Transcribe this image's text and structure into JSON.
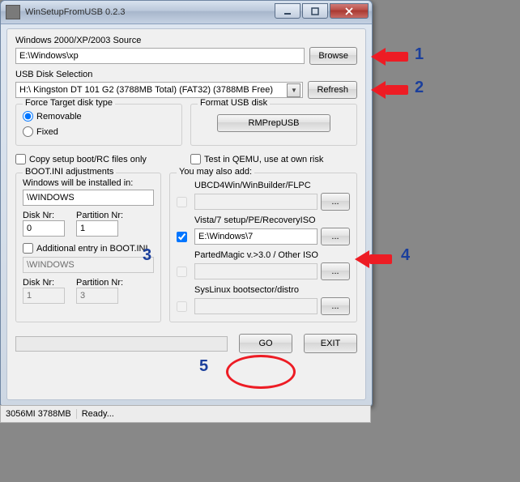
{
  "window": {
    "title": "WinSetupFromUSB 0.2.3"
  },
  "source": {
    "label": "Windows 2000/XP/2003 Source",
    "value": "E:\\Windows\\xp",
    "browse": "Browse"
  },
  "usb": {
    "label": "USB Disk Selection",
    "value": "H:\\ Kingston DT 101 G2 (3788MB Total) (FAT32) (3788MB Free)",
    "refresh": "Refresh"
  },
  "force": {
    "legend": "Force Target disk type",
    "removable": "Removable",
    "fixed": "Fixed"
  },
  "format": {
    "legend": "Format USB disk",
    "rmprep": "RMPrepUSB"
  },
  "copy_rc": "Copy setup boot/RC files only",
  "test_qemu": "Test in QEMU, use at own risk",
  "bootini": {
    "legend": "BOOT.INI adjustments",
    "installed_in": "Windows will be installed in:",
    "path1": "\\WINDOWS",
    "disknr_lbl": "Disk Nr:",
    "disknr1": "0",
    "partnr_lbl": "Partition Nr:",
    "partnr1": "1",
    "additional": "Additional entry in BOOT.INI",
    "path2": "\\WINDOWS",
    "disknr2": "1",
    "partnr2": "3"
  },
  "also": {
    "legend": "You may also add:",
    "items": [
      {
        "label": "UBCD4Win/WinBuilder/FLPC",
        "value": "",
        "checked": false,
        "enabled": false,
        "browse": "..."
      },
      {
        "label": "Vista/7 setup/PE/RecoveryISO",
        "value": "E:\\Windows\\7",
        "checked": true,
        "enabled": true,
        "browse": "..."
      },
      {
        "label": "PartedMagic v.>3.0 / Other ISO",
        "value": "",
        "checked": false,
        "enabled": false,
        "browse": "..."
      },
      {
        "label": "SysLinux bootsector/distro",
        "value": "",
        "checked": false,
        "enabled": false,
        "browse": "..."
      }
    ]
  },
  "buttons": {
    "go": "GO",
    "exit": "EXIT"
  },
  "status": {
    "left": "3056MI 3788MB",
    "right": "Ready..."
  },
  "anno": {
    "1": "1",
    "2": "2",
    "3": "3",
    "4": "4",
    "5": "5"
  }
}
